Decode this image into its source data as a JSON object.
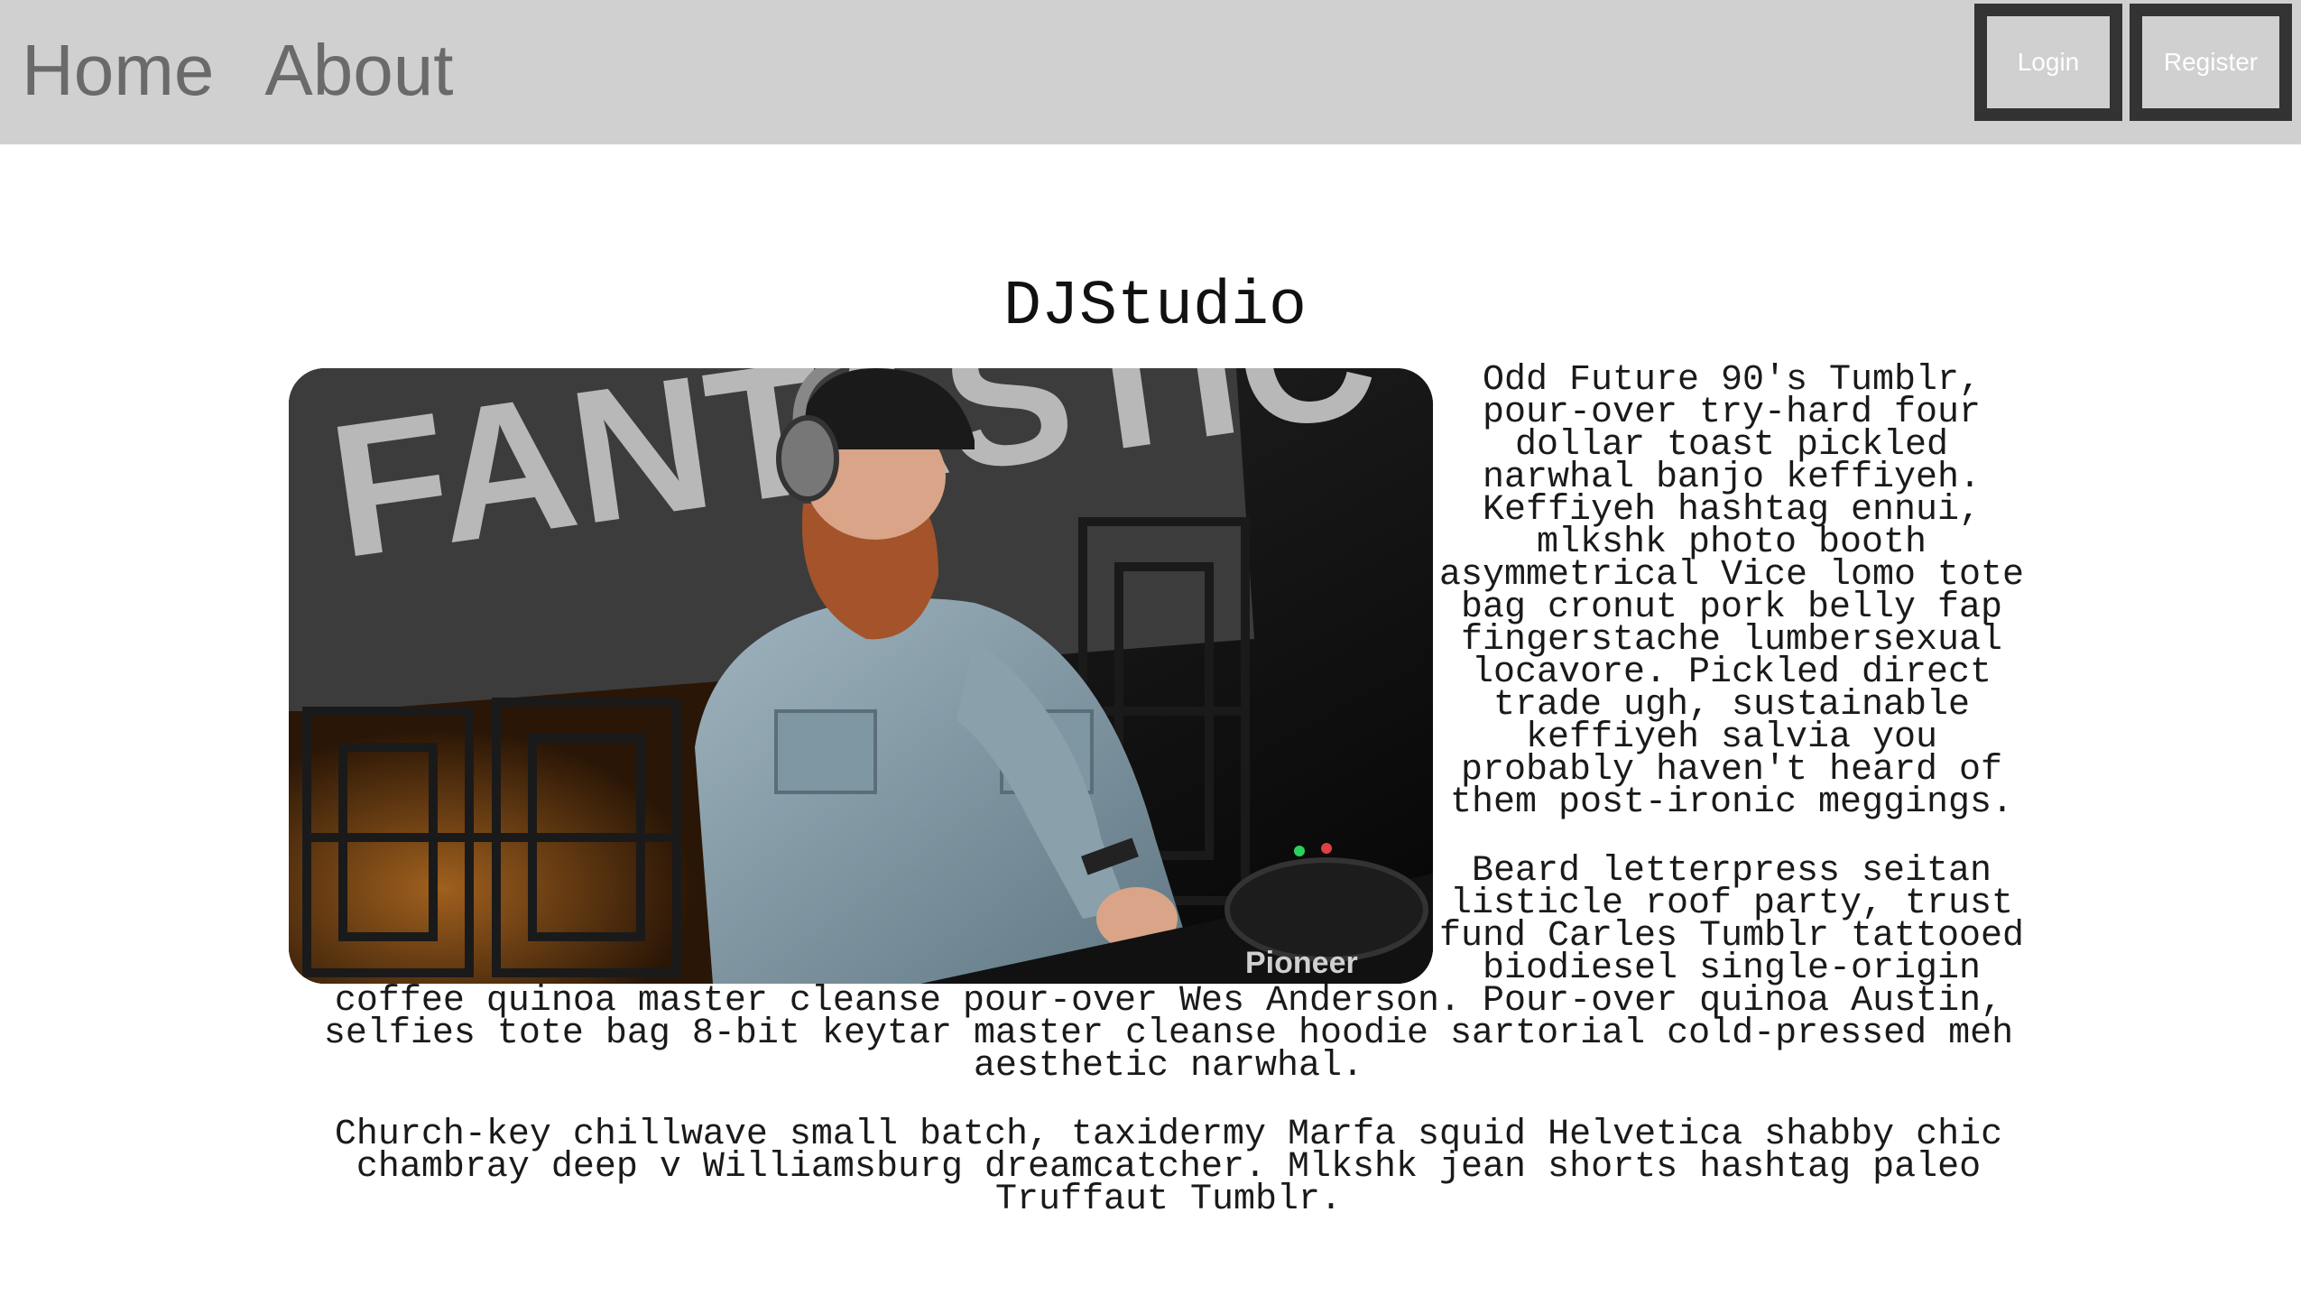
{
  "nav": {
    "links": [
      {
        "label": "Home"
      },
      {
        "label": "About"
      }
    ],
    "login_label": "Login",
    "register_label": "Register"
  },
  "page": {
    "title": "DJStudio",
    "image": {
      "banner_text": "FANTASTIC",
      "deck_brand": "Pioneer"
    },
    "paragraphs": [
      "Odd Future 90's Tumblr, pour-over try-hard four dollar toast pickled narwhal banjo keffiyeh. Keffiyeh hashtag ennui, mlkshk photo booth asymmetrical Vice lomo tote bag cronut pork belly fap fingerstache lumbersexual locavore. Pickled direct trade ugh, sustainable keffiyeh salvia you probably haven't heard of them post-ironic meggings.",
      "Beard letterpress seitan listicle roof party, trust fund Carles Tumblr tattooed biodiesel single-origin coffee quinoa master cleanse pour-over Wes Anderson. Pour-over quinoa Austin, selfies tote bag 8-bit keytar master cleanse hoodie sartorial cold-pressed meh aesthetic narwhal.",
      "Church-key chillwave small batch, taxidermy Marfa squid Helvetica shabby chic chambray deep v Williamsburg dreamcatcher. Mlkshk jean shorts hashtag paleo Truffaut Tumblr."
    ]
  },
  "colors": {
    "nav_bg": "#d0d0d0",
    "nav_link": "#6a6a6a",
    "button_border": "#333333",
    "button_text": "#ffffff",
    "body_text": "#1a1a1a"
  }
}
